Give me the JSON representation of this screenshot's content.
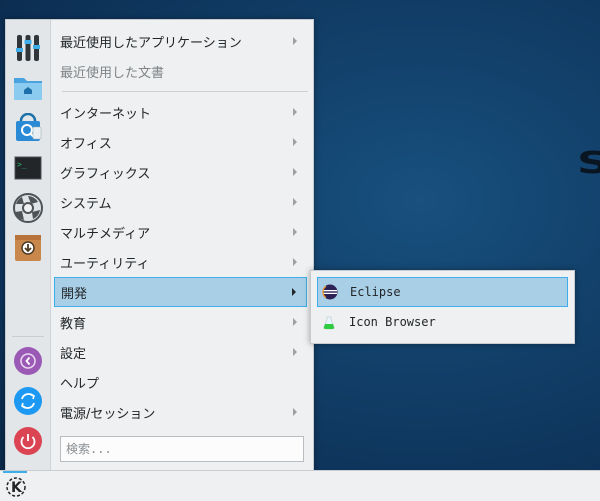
{
  "menu": {
    "items": [
      {
        "label": "最近使用したアプリケーション",
        "has_submenu": true
      },
      {
        "label": "最近使用した文書",
        "has_submenu": false,
        "disabled": true
      },
      {
        "label": "インターネット",
        "has_submenu": true
      },
      {
        "label": "オフィス",
        "has_submenu": true
      },
      {
        "label": "グラフィックス",
        "has_submenu": true
      },
      {
        "label": "システム",
        "has_submenu": true
      },
      {
        "label": "マルチメディア",
        "has_submenu": true
      },
      {
        "label": "ユーティリティ",
        "has_submenu": true
      },
      {
        "label": "開発",
        "has_submenu": true,
        "active": true
      },
      {
        "label": "教育",
        "has_submenu": true
      },
      {
        "label": "設定",
        "has_submenu": true
      },
      {
        "label": "ヘルプ",
        "has_submenu": false
      },
      {
        "label": "電源/セッション",
        "has_submenu": true
      }
    ],
    "search_placeholder": "検索..."
  },
  "favorites": [
    {
      "icon": "mixer-icon"
    },
    {
      "icon": "home-folder-icon"
    },
    {
      "icon": "software-store-icon"
    },
    {
      "icon": "terminal-icon"
    },
    {
      "icon": "system-settings-icon"
    },
    {
      "icon": "archive-icon"
    }
  ],
  "session_actions": [
    {
      "icon": "lock-screen-icon",
      "color": "#9b59b6"
    },
    {
      "icon": "switch-user-icon",
      "color": "#1d99f3"
    },
    {
      "icon": "power-icon",
      "color": "#da4453"
    }
  ],
  "submenu": {
    "items": [
      {
        "label": "Eclipse",
        "icon": "eclipse-icon",
        "active": true
      },
      {
        "label": "Icon Browser",
        "icon": "icon-browser-icon"
      }
    ]
  },
  "terminal_prompt": ">_",
  "panel": {
    "launcher_icon": "kde-logo-icon",
    "launcher_letter": "K"
  },
  "desktop": {
    "watermark_text": "S"
  },
  "colors": {
    "accent": "#3daee9",
    "selection": "#a8cfe6"
  }
}
